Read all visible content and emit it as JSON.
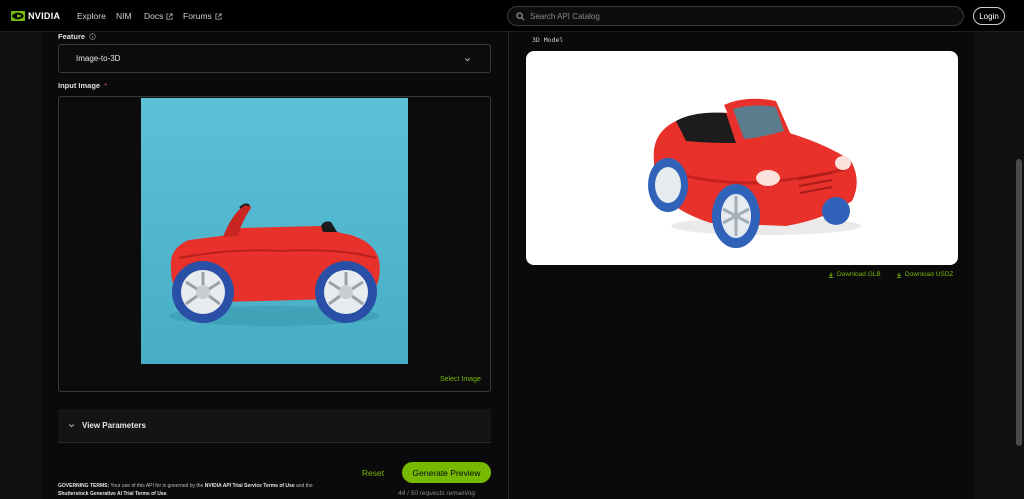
{
  "nav": {
    "brand": "NVIDIA",
    "links": [
      "Explore",
      "NIM",
      "Docs",
      "Forums"
    ],
    "search_placeholder": "Search API Catalog",
    "login": "Login"
  },
  "left": {
    "feature_label": "Feature",
    "feature_value": "Image-to-3D",
    "input_label": "Input Image",
    "required_mark": "*",
    "select_image": "Select Image",
    "view_parameters": "View Parameters",
    "reset": "Reset",
    "generate": "Generate Preview",
    "remaining": "44 / 50 requests remaining",
    "terms": {
      "prefix": "GOVERNING TERMS:",
      "part1": " Your use of this API for is governed by the ",
      "link1": "NVIDIA API Trial Service Terms of Use",
      "part2": " and the ",
      "link2": "Shutterstock Generative AI Trial Terms of Use",
      "part3": "."
    }
  },
  "right": {
    "model_label": "3D Model",
    "download_glb": "Download GLB",
    "download_usdz": "Download USDZ"
  },
  "colors": {
    "accent": "#76b900",
    "background": "#0a0a0a",
    "input_bg": "#5ab9d1",
    "car_red": "#e8312b"
  }
}
